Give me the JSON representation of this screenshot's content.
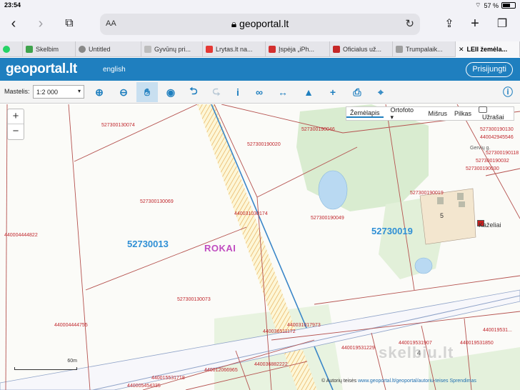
{
  "status": {
    "time": "23:54",
    "battery": "57 %"
  },
  "browser": {
    "text_size_label": "AA",
    "url": "geoportal.lt",
    "tabs": [
      {
        "label": "Skelbim",
        "color": "#3fa34d"
      },
      {
        "label": "Untitled",
        "color": "#888888"
      },
      {
        "label": "Gyvūnų pri...",
        "color": "#bdbdbd"
      },
      {
        "label": "Lrytas.lt na...",
        "color": "#e53935"
      },
      {
        "label": "Įspėja „iPh...",
        "color": "#d32f2f"
      },
      {
        "label": "Oficialus už...",
        "color": "#c62828"
      },
      {
        "label": "Trumpalaik...",
        "color": "#9e9e9e"
      },
      {
        "label": "LEII žemėla...",
        "color": "#1f7fbf"
      }
    ]
  },
  "geoportal": {
    "logo": "geoportal.lt",
    "language": "english",
    "login": "Prisijungti",
    "scale_label": "Mastelis:",
    "scale_value": "1:2 000"
  },
  "layers": {
    "zemelapis": "Žemėlapis",
    "ortofoto": "Ortofoto",
    "misrus": "Mišrus",
    "pilkas": "Pilkas",
    "uzrasai": "Užrašai"
  },
  "map": {
    "parcels": [
      {
        "t": "527300130074"
      },
      {
        "t": "527300190020"
      },
      {
        "t": "527300190046"
      },
      {
        "t": "527300190130"
      },
      {
        "t": "440042945546"
      },
      {
        "t": "Gervių g."
      },
      {
        "t": "527300190118"
      },
      {
        "t": "527300190032"
      },
      {
        "t": "527300190030"
      },
      {
        "t": "527300190019"
      },
      {
        "t": "527300130069"
      },
      {
        "t": "440031030174"
      },
      {
        "t": "527300190049"
      },
      {
        "t": "440004444822"
      },
      {
        "t": "527300130073"
      },
      {
        "t": "440004444755"
      },
      {
        "t": "440031017973"
      },
      {
        "t": "440036511172"
      },
      {
        "t": "440019531907"
      },
      {
        "t": "440019531850"
      },
      {
        "t": "440019531..."
      },
      {
        "t": "440019531229"
      },
      {
        "t": "440036882222"
      },
      {
        "t": "440012066965"
      },
      {
        "t": "440015531718"
      },
      {
        "t": "440005454335"
      }
    ],
    "blocks": [
      "52730013",
      "52730019"
    ],
    "place": "ROKAI",
    "village": "Kaželiai",
    "plot_numbers": [
      "5",
      "4"
    ],
    "scalebar": "60m",
    "watermark": "skelbiu.lt",
    "copyright_prefix": "© Autorių teisės",
    "copyright_link": "www.geoportal.lt/geoportal/autoriu-teises",
    "terms": "Sprendimas"
  }
}
